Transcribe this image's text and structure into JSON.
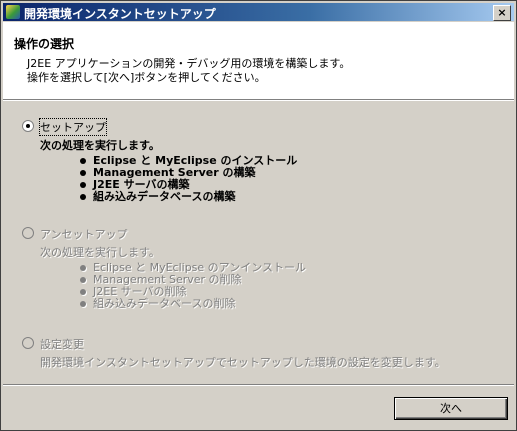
{
  "window": {
    "title": "開発環境インスタントセットアップ",
    "close_glyph": "×"
  },
  "header": {
    "title": "操作の選択",
    "line1": "J2EE アプリケーションの開発・デバッグ用の環境を構築します。",
    "line2": "操作を選択して[次へ]ボタンを押してください。"
  },
  "options": [
    {
      "label": "セットアップ",
      "selected": true,
      "enabled": true,
      "description": "次の処理を実行します。",
      "items": [
        "Eclipse と MyEclipse のインストール",
        "Management Server の構築",
        "J2EE サーバの構築",
        "組み込みデータベースの構築"
      ]
    },
    {
      "label": "アンセットアップ",
      "selected": false,
      "enabled": false,
      "description": "次の処理を実行します。",
      "items": [
        "Eclipse と MyEclipse のアンインストール",
        "Management Server の削除",
        "J2EE サーバの削除",
        "組み込みデータベースの削除"
      ]
    },
    {
      "label": "設定変更",
      "selected": false,
      "enabled": false,
      "description": "開発環境インスタントセットアップでセットアップした環境の設定を変更します。",
      "items": []
    }
  ],
  "footer": {
    "next_label": "次へ"
  }
}
